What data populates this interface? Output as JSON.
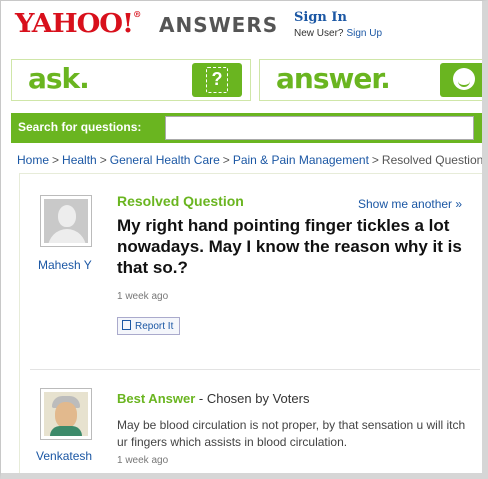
{
  "header": {
    "logo_text": "YAHOO!",
    "logo_mark": "®",
    "answers_text": "ANSWERS",
    "sign_in": "Sign In",
    "new_user": "New User?",
    "sign_up": "Sign Up"
  },
  "ask_tile": {
    "label": "ask.",
    "badge": "?"
  },
  "answer_tile": {
    "label": "answer.",
    "badge_icon": "smiley-icon"
  },
  "search": {
    "label": "Search for questions:",
    "value": ""
  },
  "breadcrumb": {
    "items": [
      "Home",
      "Health",
      "General Health Care",
      "Pain & Pain Management",
      "Resolved Question"
    ],
    "separator": ">"
  },
  "question": {
    "label": "Resolved Question",
    "show_another": "Show me another »",
    "asker": "Mahesh Y",
    "title": "My right hand pointing finger tickles a lot nowadays. May I know the reason why it is that so.?",
    "time": "1 week ago",
    "report": "Report It"
  },
  "best_answer": {
    "label": "Best Answer",
    "chosen_by": " - Chosen by Voters",
    "answerer": "Venkatesh",
    "text": "May be blood circulation is not proper, by that sensation u will itch ur fingers which assists in blood circulation.",
    "time": "1 week ago"
  },
  "colors": {
    "brand_red": "#d8101c",
    "accent_green": "#6ab520",
    "link_blue": "#1b57a4"
  }
}
